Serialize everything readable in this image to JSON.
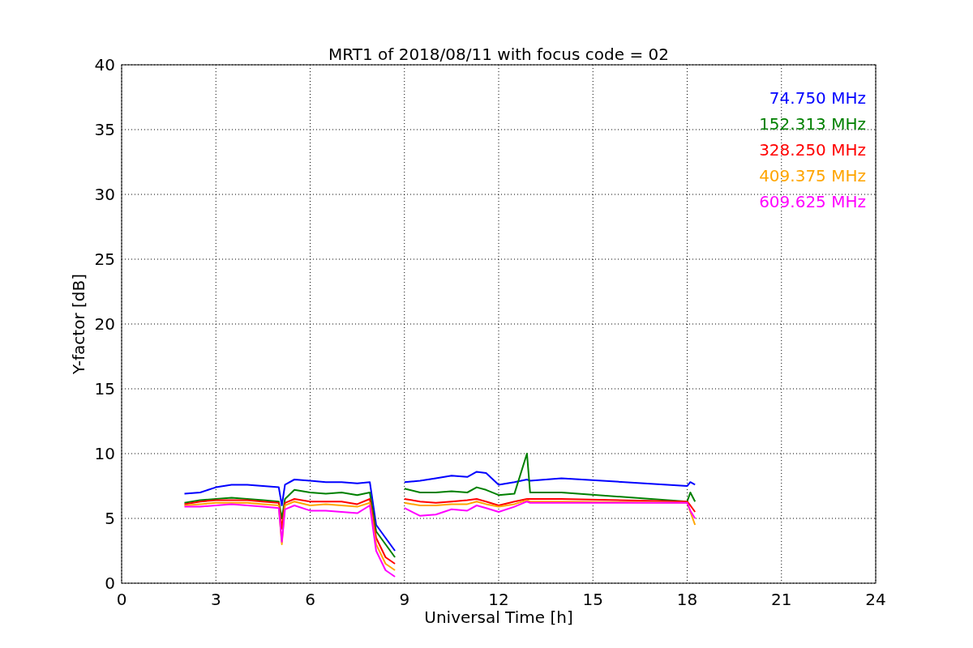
{
  "chart_data": {
    "type": "line",
    "grid": true,
    "title": "MRT1 of 2018/08/11 with focus code = 02",
    "xlabel": "Universal Time [h]",
    "ylabel": "Y-factor [dB]",
    "xlim": [
      0,
      24
    ],
    "ylim": [
      0,
      40
    ],
    "xticks": [
      0,
      3,
      6,
      9,
      12,
      15,
      18,
      21,
      24
    ],
    "yticks": [
      0,
      5,
      10,
      15,
      20,
      25,
      30,
      35,
      40
    ],
    "x": [
      2,
      2.5,
      3,
      3.5,
      4,
      4.5,
      5,
      5.1,
      5.2,
      5.5,
      6,
      6.5,
      7,
      7.5,
      7.9,
      8.1,
      8.4,
      8.7,
      8.8,
      9,
      9.5,
      10,
      10.5,
      11,
      11.3,
      11.6,
      12,
      12.5,
      12.9,
      13,
      13.5,
      14,
      18,
      18.1,
      18.25
    ],
    "series": [
      {
        "name": "74.750 MHz",
        "color": "#0000ff",
        "values": [
          6.9,
          7.0,
          7.4,
          7.6,
          7.6,
          7.5,
          7.4,
          6.0,
          7.6,
          8.0,
          7.9,
          7.8,
          7.8,
          7.7,
          7.8,
          4.5,
          3.5,
          2.5,
          null,
          7.8,
          7.9,
          8.1,
          8.3,
          8.2,
          8.6,
          8.5,
          7.6,
          7.8,
          8.0,
          7.9,
          8.0,
          8.1,
          7.5,
          7.8,
          7.6
        ]
      },
      {
        "name": "152.313 MHz",
        "color": "#008000",
        "values": [
          6.2,
          6.4,
          6.5,
          6.6,
          6.5,
          6.4,
          6.3,
          5.0,
          6.5,
          7.2,
          7.0,
          6.9,
          7.0,
          6.8,
          7.0,
          4.0,
          3.0,
          2.0,
          null,
          7.3,
          7.0,
          7.0,
          7.1,
          7.0,
          7.4,
          7.2,
          6.8,
          6.9,
          10.0,
          7.0,
          7.0,
          7.0,
          6.3,
          7.0,
          6.3
        ]
      },
      {
        "name": "328.250 MHz",
        "color": "#ff0000",
        "values": [
          6.1,
          6.3,
          6.4,
          6.4,
          6.4,
          6.3,
          6.2,
          4.2,
          6.2,
          6.5,
          6.3,
          6.3,
          6.3,
          6.1,
          6.5,
          3.5,
          2.0,
          1.5,
          null,
          6.5,
          6.3,
          6.2,
          6.3,
          6.4,
          6.5,
          6.3,
          6.0,
          6.3,
          6.5,
          6.5,
          6.5,
          6.5,
          6.3,
          6.0,
          5.5
        ]
      },
      {
        "name": "409.375 MHz",
        "color": "#ffa500",
        "values": [
          6.0,
          6.1,
          6.2,
          6.2,
          6.2,
          6.1,
          6.0,
          3.0,
          6.0,
          6.3,
          6.0,
          6.1,
          6.0,
          5.9,
          6.2,
          3.0,
          1.5,
          1.0,
          null,
          6.2,
          6.0,
          6.0,
          6.1,
          6.1,
          6.3,
          6.1,
          5.9,
          6.1,
          6.4,
          6.3,
          6.3,
          6.3,
          6.2,
          5.5,
          4.5
        ]
      },
      {
        "name": "609.625 MHz",
        "color": "#ff00ff",
        "values": [
          5.9,
          5.9,
          6.0,
          6.1,
          6.0,
          5.9,
          5.8,
          3.2,
          5.7,
          6.0,
          5.6,
          5.6,
          5.5,
          5.4,
          6.0,
          2.5,
          1.0,
          0.5,
          null,
          5.8,
          5.2,
          5.3,
          5.7,
          5.6,
          6.0,
          5.8,
          5.5,
          5.9,
          6.3,
          6.2,
          6.2,
          6.2,
          6.2,
          5.6,
          5.0
        ]
      }
    ]
  }
}
